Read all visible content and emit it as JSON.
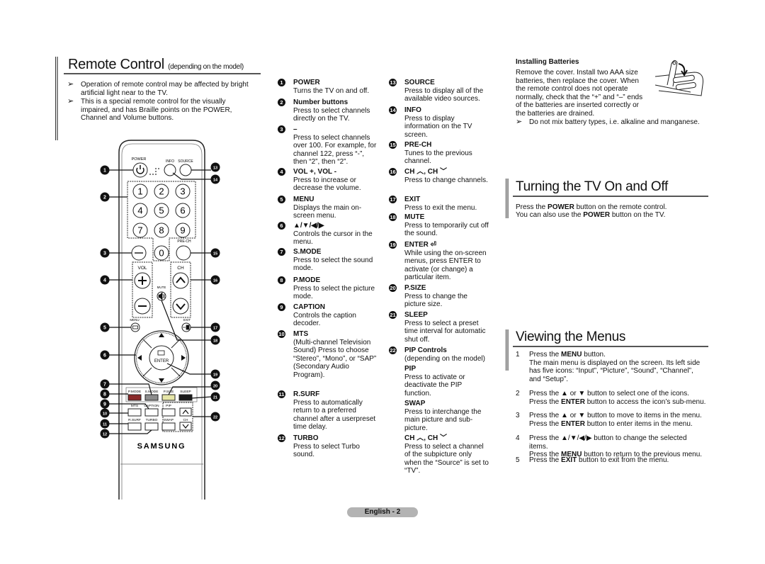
{
  "remote_section": {
    "title": "Remote Control",
    "subtitle": "(depending on the model)",
    "notes": [
      "Operation of remote control may be affected by bright artificial light near to the TV.",
      "This is a special remote control for the visually impaired, and has Braille points on the POWER, Channel and Volume buttons."
    ],
    "note_icon": "arrow-bullet-icon"
  },
  "remote_illustration": {
    "brand": "SAMSUNG",
    "labels": {
      "power": "POWER",
      "info": "INFO",
      "source": "SOURCE",
      "prech": "PRE-CH",
      "vol": "VOL",
      "ch": "CH",
      "mute": "MUTE",
      "menu": "MENU",
      "exit": "EXIT",
      "enter": "ENTER",
      "pmode": "P.MODE",
      "smode": "S.MODE",
      "psize": "P.SIZE",
      "sleep": "SLEEP",
      "mts": "MTS",
      "caption": "CAPTION",
      "pip": "PIP",
      "rsurf": "R.SURF",
      "turbo": "TURBO",
      "swap": "SWAP",
      "ch2": "CH"
    },
    "digits": [
      "1",
      "2",
      "3",
      "4",
      "5",
      "6",
      "7",
      "8",
      "9",
      "0"
    ],
    "dash": "—",
    "callouts": [
      "1",
      "2",
      "3",
      "4",
      "5",
      "6",
      "7",
      "8",
      "9",
      "10",
      "11",
      "12",
      "13",
      "14",
      "15",
      "16",
      "17",
      "18",
      "19",
      "20",
      "21",
      "22"
    ],
    "colors": {
      "pmode": "#8a2a2a",
      "smode": "#8c8c8c",
      "psize": "#e6e6a8",
      "sleep": "#1a1a1a"
    }
  },
  "buttons_col1": [
    {
      "num": "1",
      "name": "POWER",
      "desc": "Turns the TV on and off."
    },
    {
      "num": "2",
      "name": "Number buttons",
      "desc": "Press to select channels directly on the TV."
    },
    {
      "num": "3",
      "name": "–",
      "desc": "Press to select channels over 100. For example, for channel 122, press “-”, then “2”, then “2”."
    },
    {
      "num": "4",
      "name": "VOL +, VOL -",
      "desc": "Press to increase or decrease the volume."
    },
    {
      "num": "5",
      "name": "MENU",
      "desc": "Displays the main on-screen menu."
    },
    {
      "num": "6",
      "name": "▲/▼/◀/▶",
      "desc": "Controls the cursor in the menu."
    },
    {
      "num": "7",
      "name": "S.MODE",
      "desc": "Press to select the sound mode."
    },
    {
      "num": "8",
      "name": "P.MODE",
      "desc": "Press to select the picture mode."
    },
    {
      "num": "9",
      "name": "CAPTION",
      "desc": "Controls the caption decoder."
    },
    {
      "num": "10",
      "name": "MTS",
      "desc": "(Multi-channel Television Sound) Press to choose “Stereo”, “Mono”, or “SAP” (Secondary Audio Program)."
    },
    {
      "num": "11",
      "name": "R.SURF",
      "desc": "Press to automatically return to a preferred channel after a userpreset time delay."
    },
    {
      "num": "12",
      "name": "TURBO",
      "desc": "Press to select Turbo sound."
    }
  ],
  "buttons_col2": [
    {
      "num": "13",
      "name": "SOURCE",
      "desc": "Press to display all of the available video sources."
    },
    {
      "num": "14",
      "name": "INFO",
      "desc": "Press to display information on the TV screen."
    },
    {
      "num": "15",
      "name": "PRE-CH",
      "desc": "Tunes to the previous channel."
    },
    {
      "num": "16",
      "name": "CH ︿, CH ﹀",
      "desc": "Press to change channels."
    },
    {
      "num": "17",
      "name": "EXIT",
      "desc": "Press to exit the menu."
    },
    {
      "num": "18",
      "name": "MUTE",
      "desc": "Press to temporarily cut off the sound."
    },
    {
      "num": "19",
      "name": "ENTER ⏎",
      "desc": "While using the on-screen menus, press ENTER to activate (or change) a particular item."
    },
    {
      "num": "20",
      "name": "P.SIZE",
      "desc": "Press to change the picture size."
    },
    {
      "num": "21",
      "name": "SLEEP",
      "desc": "Press to select a preset time interval for automatic shut off."
    },
    {
      "num": "22",
      "name": "PIP Controls",
      "desc": "(depending on the model)",
      "subs": [
        {
          "name": "PIP",
          "desc": "Press to activate or deactivate the PIP function."
        },
        {
          "name": "SWAP",
          "desc": "Press to interchange the main picture and sub-picture."
        },
        {
          "name": "CH ︿, CH ﹀",
          "desc": "Press to select a channel of the subpicture only when the “Source” is set to “TV”."
        }
      ]
    }
  ],
  "batteries": {
    "title": "Installing Batteries",
    "text": "Remove the cover. Install two AAA size batteries, then replace the cover. When the remote control does not operate normally, check that the “+” and “–” ends of the batteries are inserted correctly or the batteries are drained.",
    "note": "Do not mix battery types, i.e. alkaline and manganese."
  },
  "turning_on": {
    "title": "Turning the TV On and Off",
    "line1_pre": "Press the ",
    "line1_bold": "POWER",
    "line1_post": " button on the remote control.",
    "line2_pre": "You can also use the ",
    "line2_bold": "POWER",
    "line2_post": " button on the TV."
  },
  "viewing_menus": {
    "title": "Viewing the Menus",
    "steps": [
      {
        "n": "1",
        "pre": "Press the ",
        "bold": "MENU",
        "post": " button.",
        "extra": "The main menu is displayed on the screen. Its left side has five icons: “Input”, “Picture”, “Sound”, “Channel”, and “Setup”."
      },
      {
        "n": "2",
        "pre": "Press the ▲ or ▼ button to select one of the icons.",
        "bold": "",
        "post": "",
        "extra_pre": "Press the ",
        "extra_bold": "ENTER",
        "extra_post": " button to access the icon’s sub-menu."
      },
      {
        "n": "3",
        "pre": "Press the ▲ or ▼ button to move to items in the menu.",
        "bold": "",
        "post": "",
        "extra_pre": "Press the ",
        "extra_bold": "ENTER",
        "extra_post": " button to enter items in the menu."
      },
      {
        "n": "4",
        "pre": "Press the ▲/▼/◀/▶ button to change the selected items.",
        "bold": "",
        "post": "",
        "extra_pre": "Press the ",
        "extra_bold": "MENU",
        "extra_post": " button to return to the previous menu."
      },
      {
        "n": "5",
        "pre": "Press the ",
        "bold": "EXIT",
        "post": " button to exit from the menu."
      }
    ]
  },
  "footer": {
    "page_label": "English - 2"
  }
}
